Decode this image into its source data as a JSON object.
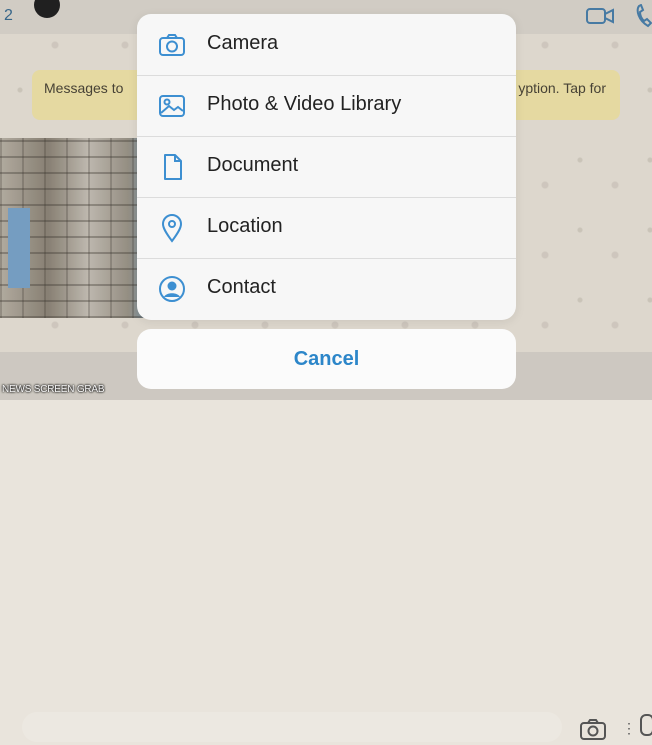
{
  "background": {
    "back_count": "2",
    "encryption_banner_left": "Messages to",
    "encryption_banner_right": "yption. Tap for",
    "watermark": "NEWS SCREEN GRAB"
  },
  "action_sheet": {
    "items": [
      {
        "label": "Camera",
        "icon": "camera-icon"
      },
      {
        "label": "Photo & Video Library",
        "icon": "photo-library-icon"
      },
      {
        "label": "Document",
        "icon": "document-icon"
      },
      {
        "label": "Location",
        "icon": "location-pin-icon"
      },
      {
        "label": "Contact",
        "icon": "contact-icon"
      }
    ],
    "cancel_label": "Cancel"
  },
  "colors": {
    "accent": "#2c86c9",
    "icon": "#3d8fd1",
    "sheet_bg": "#f7f7f7",
    "banner": "#efe2a8"
  }
}
